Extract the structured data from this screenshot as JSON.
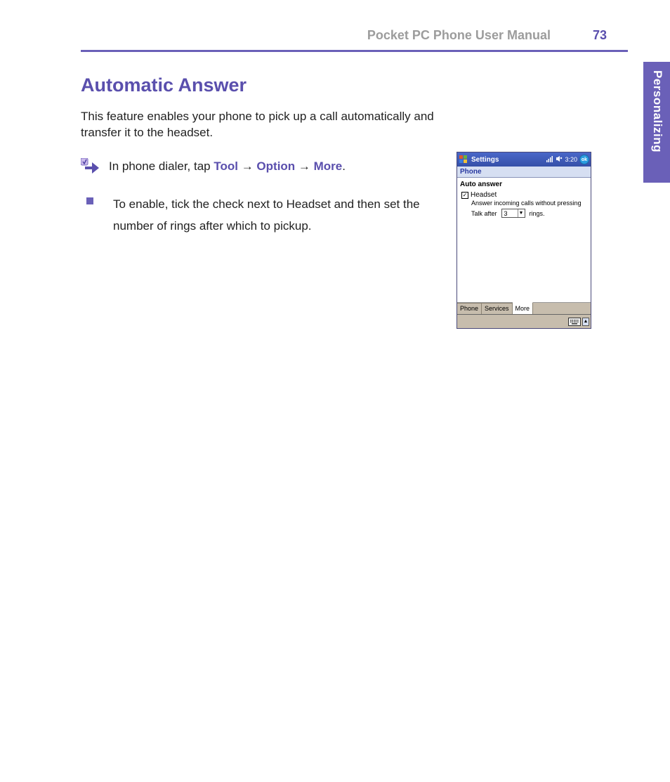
{
  "header": {
    "manual_title": "Pocket PC Phone User Manual",
    "page_number": "73"
  },
  "side_tab": "Personalizing",
  "section": {
    "title": "Automatic Answer",
    "intro": "This feature enables your phone to pick up a call automatically and transfer it to the headset."
  },
  "nav": {
    "prefix": "In phone dialer, tap ",
    "step1": "Tool",
    "sep": " → ",
    "step2": "Option",
    "step3": "More",
    "suffix": "."
  },
  "bullet": {
    "text": "To enable, tick the check next to Headset and then set the number of rings after which to pickup."
  },
  "device": {
    "taskbar": {
      "title": "Settings",
      "time": "3:20",
      "ok": "ok"
    },
    "subheader": "Phone",
    "panel": {
      "title": "Auto answer",
      "checkbox_label": "Headset",
      "checkbox_checked": "✓",
      "desc": "Answer incoming calls without pressing",
      "talk_prefix": "Talk after",
      "rings_value": "3",
      "talk_suffix": "rings."
    },
    "tabs": {
      "phone": "Phone",
      "services": "Services",
      "more": "More"
    }
  }
}
